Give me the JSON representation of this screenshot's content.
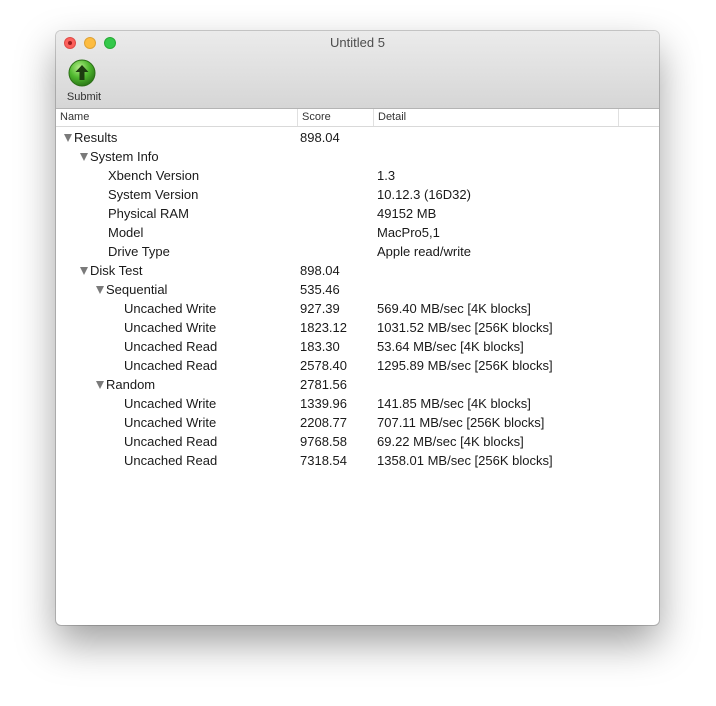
{
  "window": {
    "title": "Untitled 5",
    "traffic_lights": [
      "close",
      "minimize",
      "zoom"
    ]
  },
  "toolbar": {
    "submit_label": "Submit",
    "submit_icon": "upload-arrow-icon"
  },
  "columns": {
    "name": "Name",
    "score": "Score",
    "detail": "Detail"
  },
  "rows": [
    {
      "name": "Results",
      "score": "898.04",
      "detail": "",
      "expanded": true
    },
    {
      "name": "System Info",
      "score": "",
      "detail": "",
      "expanded": true
    },
    {
      "name": "Xbench Version",
      "score": "",
      "detail": "1.3"
    },
    {
      "name": "System Version",
      "score": "",
      "detail": "10.12.3 (16D32)"
    },
    {
      "name": "Physical RAM",
      "score": "",
      "detail": "49152 MB"
    },
    {
      "name": "Model",
      "score": "",
      "detail": "MacPro5,1"
    },
    {
      "name": "Drive Type",
      "score": "",
      "detail": "Apple read/write"
    },
    {
      "name": "Disk Test",
      "score": "898.04",
      "detail": "",
      "expanded": true
    },
    {
      "name": "Sequential",
      "score": "535.46",
      "detail": "",
      "expanded": true
    },
    {
      "name": "Uncached Write",
      "score": "927.39",
      "detail": "569.40 MB/sec [4K blocks]"
    },
    {
      "name": "Uncached Write",
      "score": "1823.12",
      "detail": "1031.52 MB/sec [256K blocks]"
    },
    {
      "name": "Uncached Read",
      "score": "183.30",
      "detail": "53.64 MB/sec [4K blocks]"
    },
    {
      "name": "Uncached Read",
      "score": "2578.40",
      "detail": "1295.89 MB/sec [256K blocks]"
    },
    {
      "name": "Random",
      "score": "2781.56",
      "detail": "",
      "expanded": true
    },
    {
      "name": "Uncached Write",
      "score": "1339.96",
      "detail": "141.85 MB/sec [4K blocks]"
    },
    {
      "name": "Uncached Write",
      "score": "2208.77",
      "detail": "707.11 MB/sec [256K blocks]"
    },
    {
      "name": "Uncached Read",
      "score": "9768.58",
      "detail": "69.22 MB/sec [4K blocks]"
    },
    {
      "name": "Uncached Read",
      "score": "7318.54",
      "detail": "1358.01 MB/sec [256K blocks]"
    }
  ]
}
